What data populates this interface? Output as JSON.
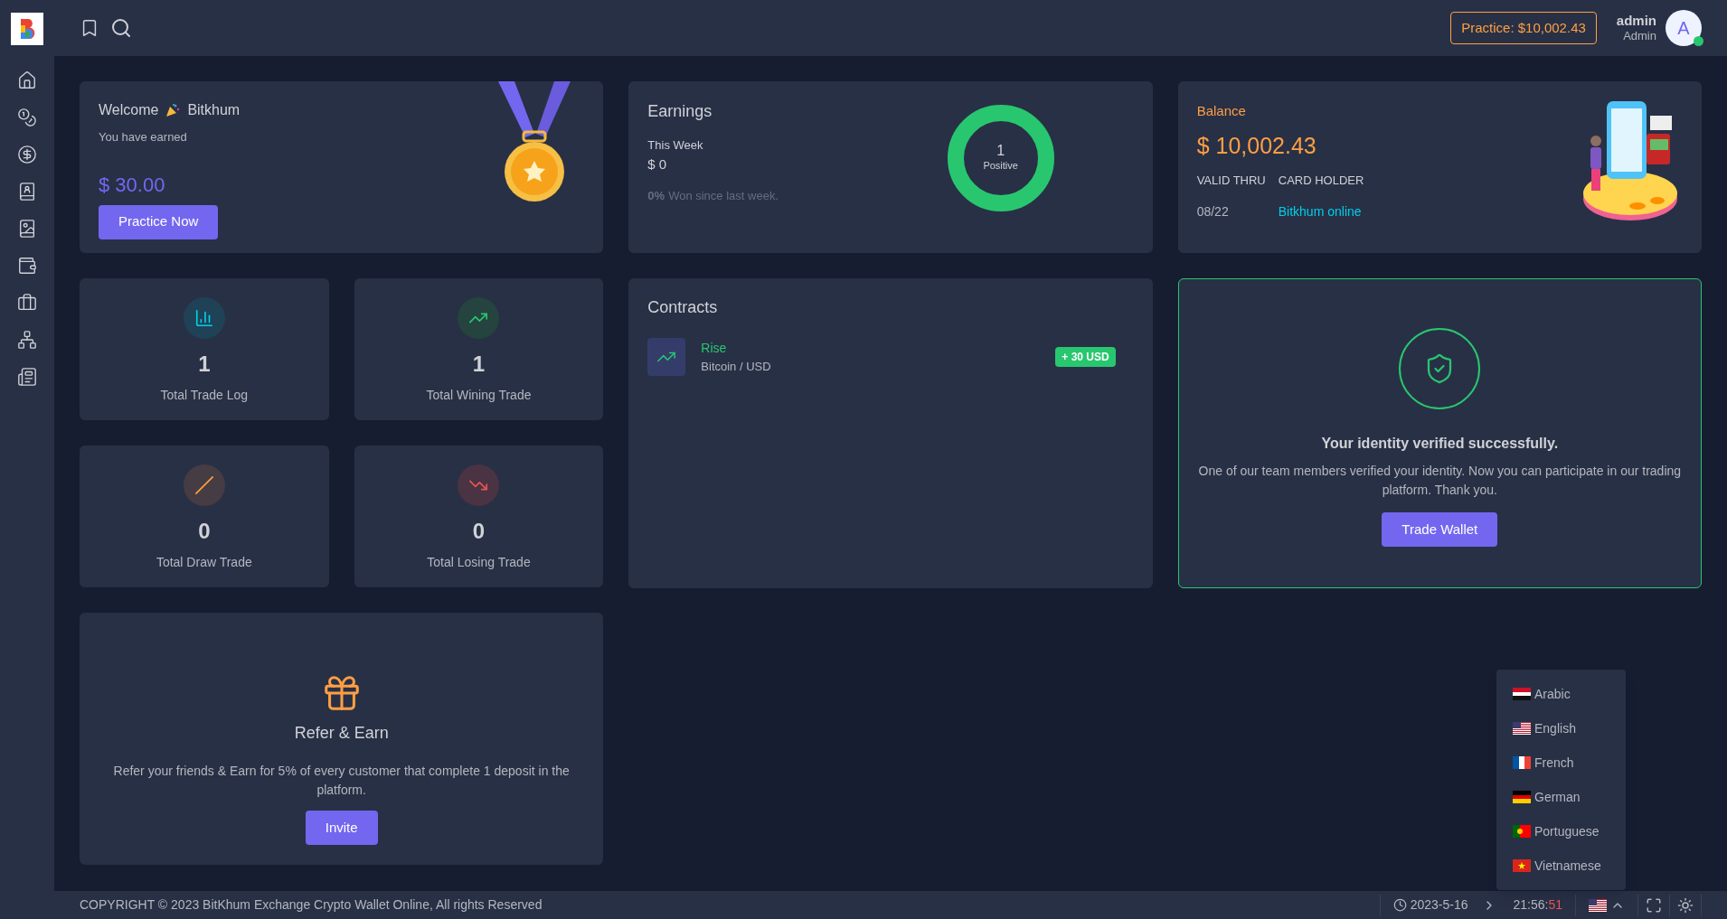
{
  "header": {
    "practice_badge": "Practice: $10,002.43",
    "user": {
      "name": "admin",
      "role": "Admin",
      "avatar": "A",
      "online": true
    }
  },
  "welcome": {
    "greeting": "Welcome",
    "name": "Bitkhum",
    "subtitle": "You have earned",
    "amount": "$ 30.00",
    "button": "Practice Now"
  },
  "earnings": {
    "title": "Earnings",
    "period": "This Week",
    "value": "$ 0",
    "change": "0%",
    "change_text": "Won since last week.",
    "donut_value": "1",
    "donut_label": "Positive"
  },
  "balance": {
    "title": "Balance",
    "amount": "$ 10,002.43",
    "valid_label": "VALID THRU",
    "holder_label": "CARD HOLDER",
    "valid": "08/22",
    "holder": "Bitkhum online"
  },
  "stats": [
    {
      "kind": "log",
      "value": "1",
      "label": "Total Trade Log"
    },
    {
      "kind": "win",
      "value": "1",
      "label": "Total Wining Trade"
    },
    {
      "kind": "draw",
      "value": "0",
      "label": "Total Draw Trade"
    },
    {
      "kind": "lose",
      "value": "0",
      "label": "Total Losing Trade"
    }
  ],
  "contracts": {
    "title": "Contracts",
    "items": [
      {
        "direction": "Rise",
        "pair": "Bitcoin / USD",
        "badge": "+ 30 USD"
      }
    ]
  },
  "identity": {
    "title": "Your identity verified successfully.",
    "text": "One of our team members verified your identity. Now you can participate in our trading platform. Thank you.",
    "button": "Trade Wallet"
  },
  "refer": {
    "title": "Refer & Earn",
    "text": "Refer your friends & Earn for 5% of every customer that complete 1 deposit in the platform.",
    "button": "Invite"
  },
  "footer": {
    "copyright": "COPYRIGHT © 2023 BitKhum Exchange Crypto Wallet Online, All rights Reserved",
    "date": "2023-5-16",
    "time": "21:56:",
    "seconds": "51"
  },
  "language_menu": {
    "open": true,
    "items": [
      {
        "label": "Arabic"
      },
      {
        "label": "English"
      },
      {
        "label": "French"
      },
      {
        "label": "German"
      },
      {
        "label": "Portuguese"
      },
      {
        "label": "Vietnamese"
      }
    ]
  }
}
